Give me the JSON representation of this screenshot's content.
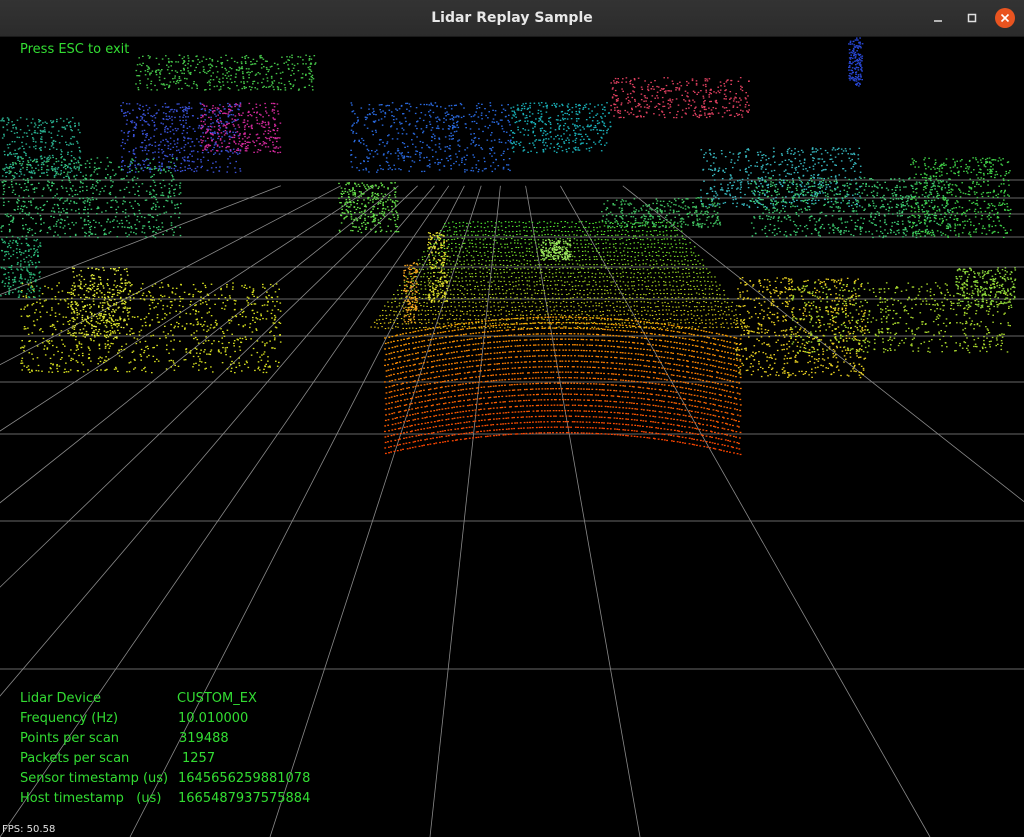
{
  "window": {
    "title": "Lidar Replay Sample",
    "controls": {
      "minimize_icon": "minimize-icon",
      "maximize_icon": "maximize-icon",
      "close_icon": "close-icon",
      "close_color": "#e95420"
    }
  },
  "hud": {
    "esc_hint": "Press ESC to exit",
    "fps": "FPS: 50.58",
    "text_color": "#33dd33",
    "info": [
      {
        "label": "Lidar Device",
        "value": "CUSTOM_EX"
      },
      {
        "label": "Frequency (Hz)",
        "value": "10.010000"
      },
      {
        "label": "Points per scan",
        "value": "319488"
      },
      {
        "label": "Packets per scan",
        "value": "1257"
      },
      {
        "label": "Sensor timestamp (us)",
        "value": "1645656259881078"
      },
      {
        "label": "Host timestamp   (us)",
        "value": "1665487937575884"
      }
    ]
  }
}
